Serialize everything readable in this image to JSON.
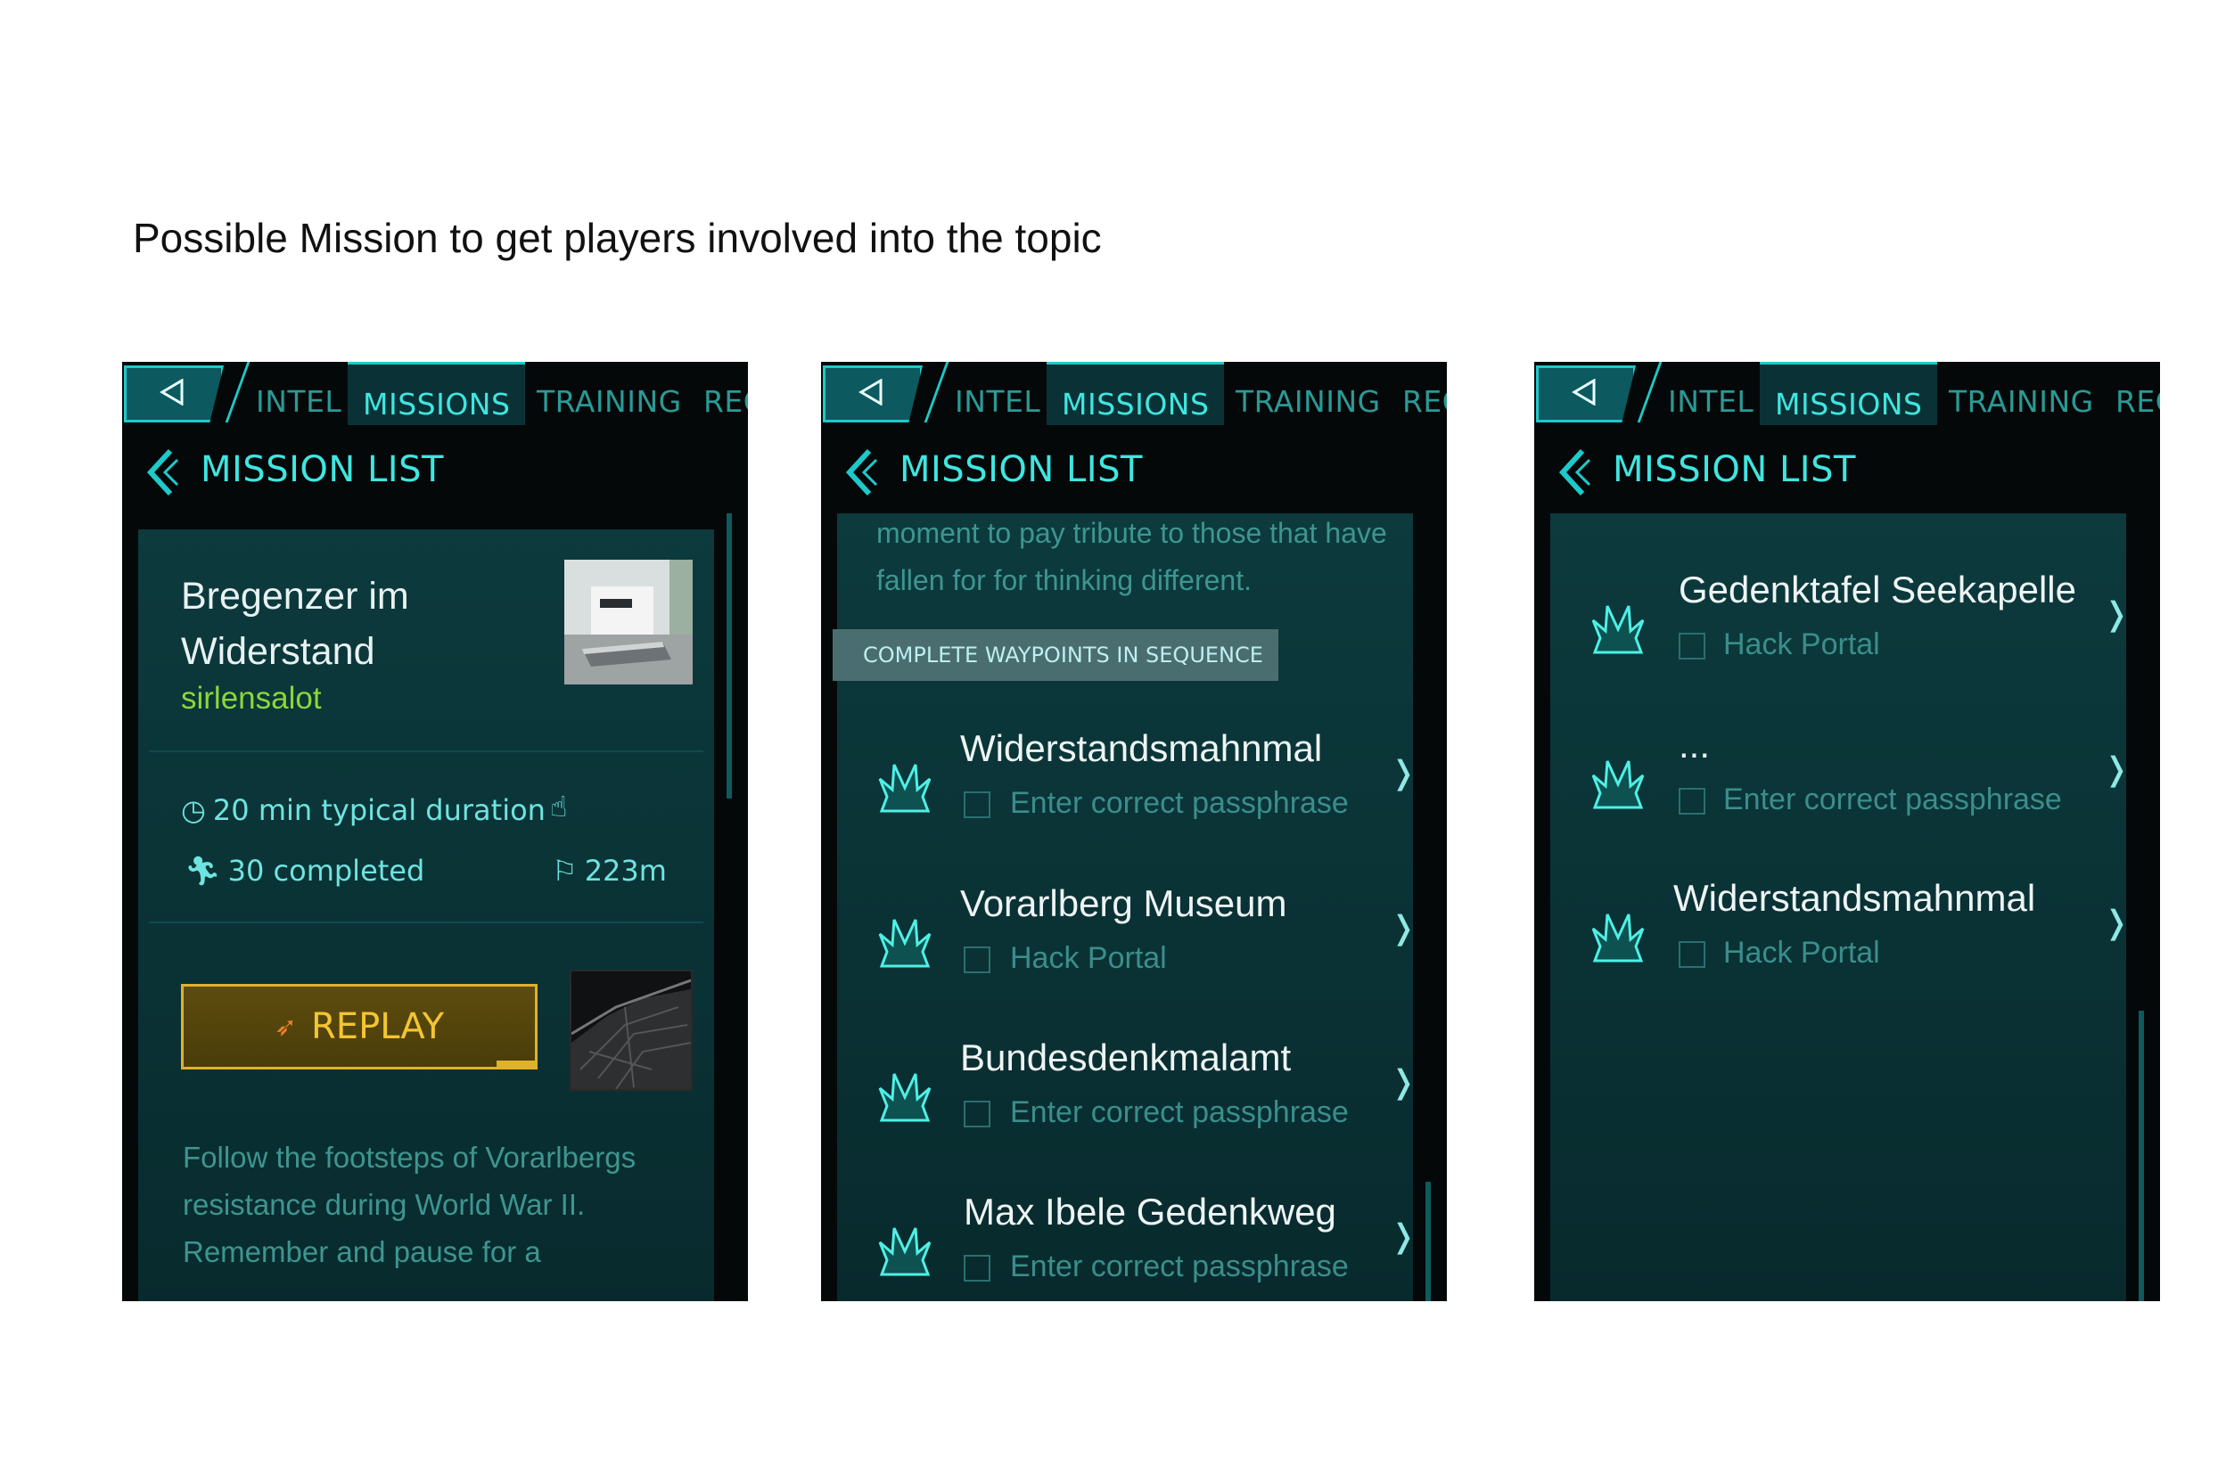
{
  "page_title": "Possible Mission to get players involved into the topic",
  "tabs": {
    "intel": "INTEL",
    "missions": "MISSIONS",
    "training": "TRAINING",
    "rec": "REC"
  },
  "header_title": "MISSION LIST",
  "colors": {
    "accent": "#3fe6e0",
    "author": "#8cd63a",
    "replay": "#f3c532",
    "panel": "#0a3134"
  },
  "phone1": {
    "mission_title": "Bregenzer im Widerstand",
    "author": "sirlensalot",
    "duration": "20 min typical duration",
    "completed": "30 completed",
    "distance": "223m",
    "replay_label": "REPLAY",
    "description": "Follow the footsteps of Vorarlbergs resistance during World War II. Remember and pause for a"
  },
  "phone2": {
    "intro": "moment to pay tribute to those that have fallen for for thinking different.",
    "sequence_banner": "COMPLETE WAYPOINTS IN SEQUENCE",
    "waypoints": [
      {
        "name": "Widerstandsmahnmal",
        "task": "Enter correct passphrase"
      },
      {
        "name": "Vorarlberg Museum",
        "task": "Hack Portal"
      },
      {
        "name": "Bundesdenkmalamt",
        "task": "Enter correct passphrase"
      },
      {
        "name": "Max Ibele Gedenkweg",
        "task": "Enter correct passphrase"
      }
    ]
  },
  "phone3": {
    "waypoints": [
      {
        "name": "Gedenktafel Seekapelle",
        "task": "Hack Portal"
      },
      {
        "name": "...",
        "task": "Enter correct passphrase"
      },
      {
        "name": "Widerstandsmahnmal",
        "task": "Hack Portal"
      }
    ]
  },
  "icons": {
    "back": "back-arrow-icon",
    "chevron": "chevron-left-icon",
    "waypoint": "portal-icon",
    "clock": "clock-icon",
    "runner": "runner-icon",
    "flag": "flag-icon",
    "thumbs": "thumbs-up-icon",
    "replay": "replay-icon",
    "arrow": "chevron-right-icon"
  }
}
